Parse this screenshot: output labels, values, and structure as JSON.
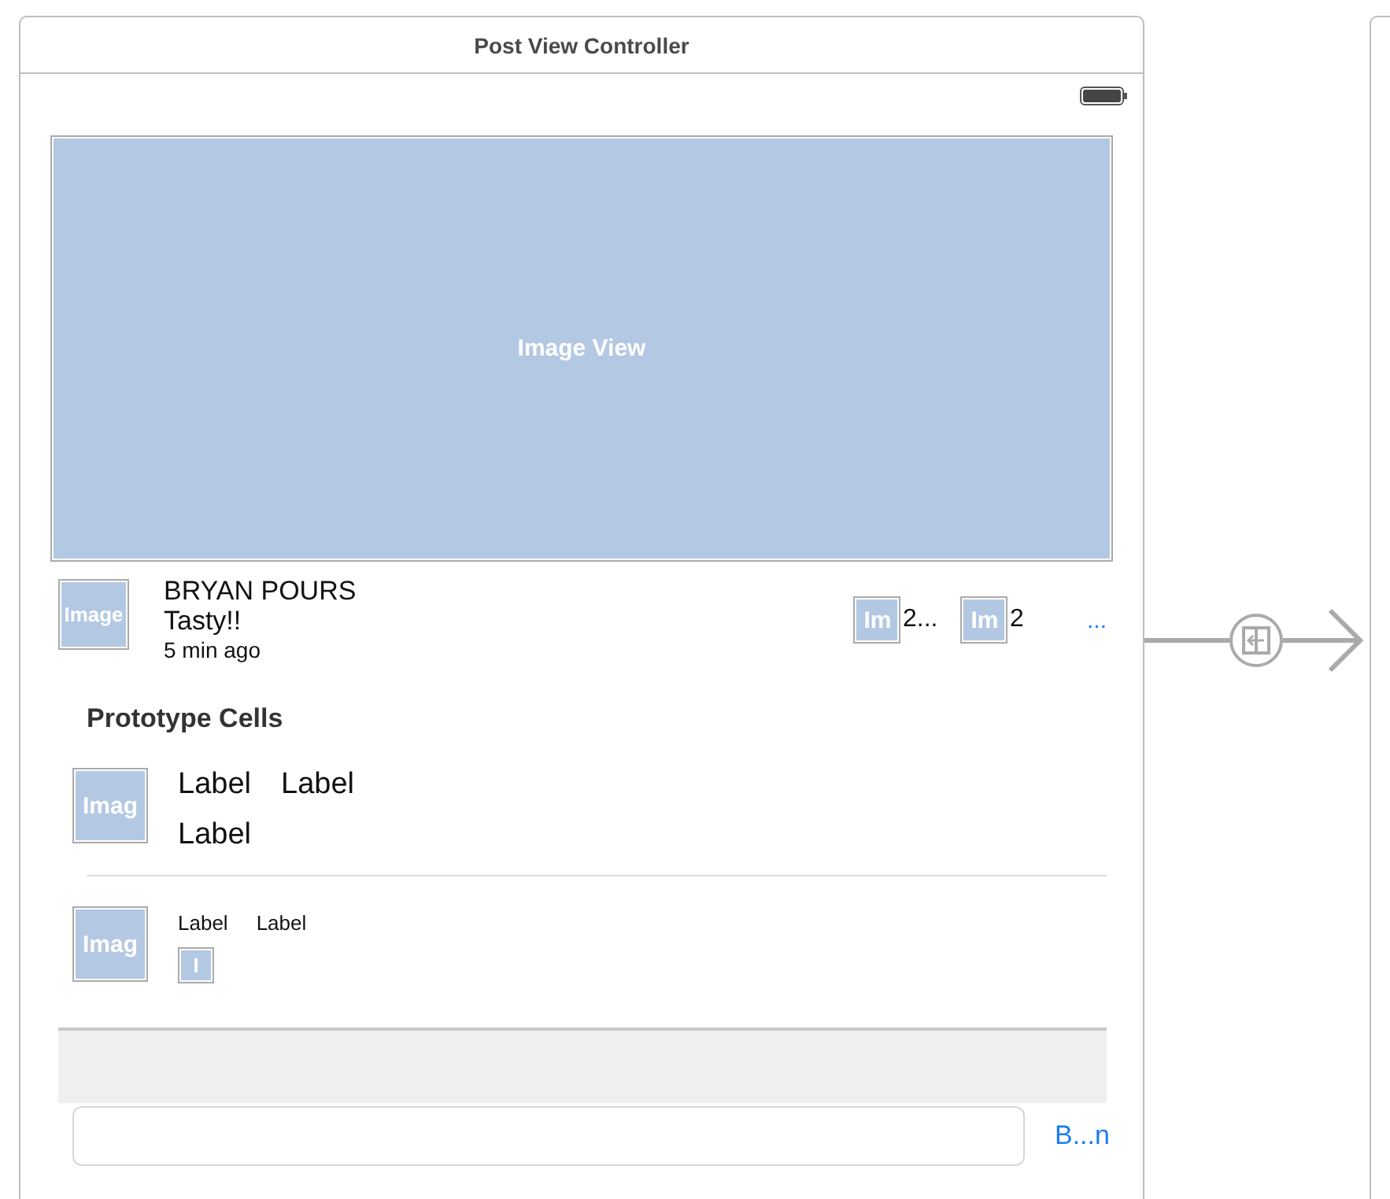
{
  "scene": {
    "title": "Post View Controller"
  },
  "image_view": {
    "label": "Image View"
  },
  "post": {
    "avatar": "Image",
    "name": "BRYAN POURS",
    "caption": "Tasty!!",
    "time": "5 min ago",
    "stats": [
      {
        "icon": "Im",
        "count": "2..."
      },
      {
        "icon": "Im",
        "count": "2"
      }
    ],
    "more": "..."
  },
  "prototype_cells": {
    "title": "Prototype Cells",
    "cells": [
      {
        "kind": "large",
        "image": "Imag",
        "labels": [
          "Label",
          "Label",
          "Label"
        ]
      },
      {
        "kind": "small",
        "image": "Imag",
        "labels": [
          "Label",
          "Label"
        ],
        "icon": "I"
      }
    ]
  },
  "input_bar": {
    "button": "B...n"
  }
}
